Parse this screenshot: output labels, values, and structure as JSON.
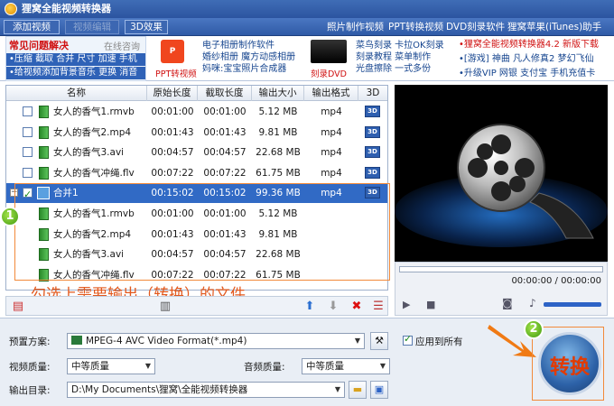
{
  "app": {
    "title": "狸窝全能视频转换器"
  },
  "toolbar": {
    "add_video": "添加视频",
    "video_edit": "视频编辑",
    "effect_3d": "3D效果",
    "links": [
      "照片制作视频",
      "PPT转换视频",
      "DVD刻录软件",
      "狸窝苹果(iTunes)助手"
    ]
  },
  "faq": {
    "title": "常见问题解决",
    "online": "在线咨询",
    "rows": [
      "•压缩 截取 合并 尺寸 加速 手机",
      "•给视频添加背景音乐 更换 消音"
    ]
  },
  "ads": {
    "ppt_logo": "PPT转视频",
    "ppt_box": "P",
    "col1": [
      "电子相册制作软件",
      "婚纱相册 魔方动感相册",
      "妈咪:宝宝照片合成器"
    ],
    "dvd_logo": "刻录DVD",
    "col2": [
      "菜鸟刻录 卡拉OK刻录",
      "刻录教程 菜单制作",
      "光盘擦除 一式多份"
    ],
    "right": [
      "•狸窝全能视频转换器4.2 新版下载",
      "•[游戏] 神曲 凡人修真2 梦幻飞仙",
      "•升级VIP 网银 支付宝 手机充值卡"
    ]
  },
  "list": {
    "headers": {
      "name": "名称",
      "duration": "原始长度",
      "cut": "截取长度",
      "size": "输出大小",
      "format": "输出格式",
      "d3": "3D"
    },
    "rows": [
      {
        "name": "女人的香气1.rmvb",
        "duration": "00:01:00",
        "cut": "00:01:00",
        "size": "5.12 MB",
        "format": "mp4",
        "checked": false,
        "child": false
      },
      {
        "name": "女人的香气2.mp4",
        "duration": "00:01:43",
        "cut": "00:01:43",
        "size": "9.81 MB",
        "format": "mp4",
        "checked": false,
        "child": false
      },
      {
        "name": "女人的香气3.avi",
        "duration": "00:04:57",
        "cut": "00:04:57",
        "size": "22.68 MB",
        "format": "mp4",
        "checked": false,
        "child": false
      },
      {
        "name": "女人的香气冲绳.flv",
        "duration": "00:07:22",
        "cut": "00:07:22",
        "size": "61.75 MB",
        "format": "mp4",
        "checked": false,
        "child": false
      },
      {
        "name": "合并1",
        "duration": "00:15:02",
        "cut": "00:15:02",
        "size": "99.36 MB",
        "format": "mp4",
        "checked": true,
        "child": false,
        "selected": true
      },
      {
        "name": "女人的香气1.rmvb",
        "duration": "00:01:00",
        "cut": "00:01:00",
        "size": "5.12 MB",
        "format": "",
        "checked": false,
        "child": true
      },
      {
        "name": "女人的香气2.mp4",
        "duration": "00:01:43",
        "cut": "00:01:43",
        "size": "9.81 MB",
        "format": "",
        "checked": false,
        "child": true
      },
      {
        "name": "女人的香气3.avi",
        "duration": "00:04:57",
        "cut": "00:04:57",
        "size": "22.68 MB",
        "format": "",
        "checked": false,
        "child": true
      },
      {
        "name": "女人的香气冲绳.flv",
        "duration": "00:07:22",
        "cut": "00:07:22",
        "size": "61.75 MB",
        "format": "",
        "checked": false,
        "child": true
      }
    ],
    "d3_label": "3D"
  },
  "annotation": {
    "text": "勾选上需要输出（转换）的文件",
    "mark1": "1",
    "mark2": "2"
  },
  "player": {
    "time": "00:00:00 / 00:00:00"
  },
  "settings": {
    "preset_label": "预置方案:",
    "preset_value": "MPEG-4 AVC Video Format(*.mp4)",
    "apply_all": "应用到所有",
    "video_quality_label": "视频质量:",
    "video_quality": "中等质量",
    "audio_quality_label": "音频质量:",
    "audio_quality": "中等质量",
    "output_dir_label": "输出目录:",
    "output_dir": "D:\\My Documents\\狸窝\\全能视频转换器",
    "apply_all_checked": true
  },
  "convert": {
    "label": "转换"
  },
  "colors": {
    "accent": "#2f5aa6",
    "selected": "#316ac5",
    "annotation": "#e2581c"
  }
}
